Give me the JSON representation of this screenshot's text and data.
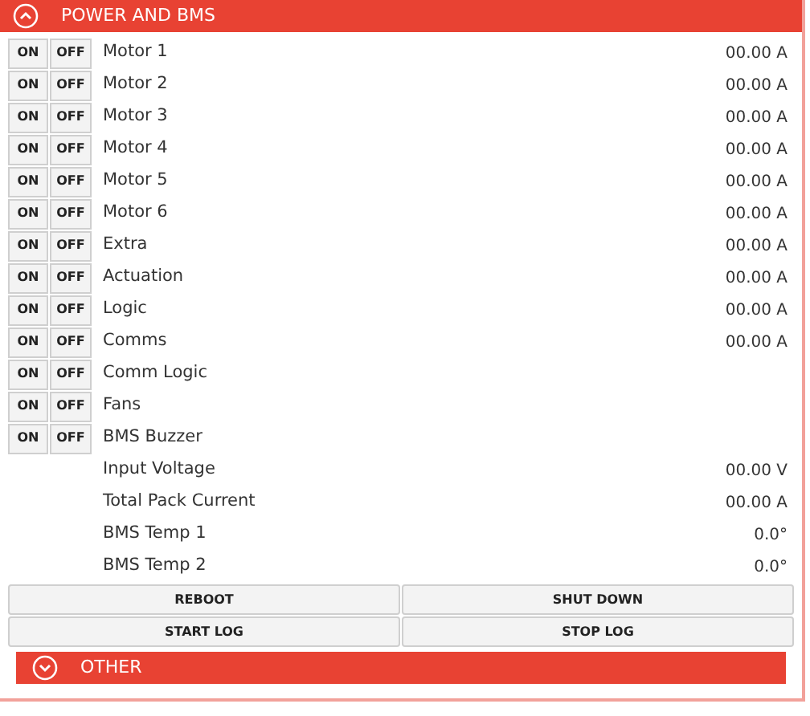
{
  "sections": [
    {
      "title": "POWER AND BMS",
      "expanded": true,
      "rows": [
        {
          "kind": "switch",
          "on_label": "ON",
          "off_label": "OFF",
          "label": "Motor 1",
          "reading": "00.00 A"
        },
        {
          "kind": "switch",
          "on_label": "ON",
          "off_label": "OFF",
          "label": "Motor 2",
          "reading": "00.00 A"
        },
        {
          "kind": "switch",
          "on_label": "ON",
          "off_label": "OFF",
          "label": "Motor 3",
          "reading": "00.00 A"
        },
        {
          "kind": "switch",
          "on_label": "ON",
          "off_label": "OFF",
          "label": "Motor 4",
          "reading": "00.00 A"
        },
        {
          "kind": "switch",
          "on_label": "ON",
          "off_label": "OFF",
          "label": "Motor 5",
          "reading": "00.00 A"
        },
        {
          "kind": "switch",
          "on_label": "ON",
          "off_label": "OFF",
          "label": "Motor 6",
          "reading": "00.00 A"
        },
        {
          "kind": "switch",
          "on_label": "ON",
          "off_label": "OFF",
          "label": "Extra",
          "reading": "00.00 A"
        },
        {
          "kind": "switch",
          "on_label": "ON",
          "off_label": "OFF",
          "label": "Actuation",
          "reading": "00.00 A"
        },
        {
          "kind": "switch",
          "on_label": "ON",
          "off_label": "OFF",
          "label": "Logic",
          "reading": "00.00 A"
        },
        {
          "kind": "switch",
          "on_label": "ON",
          "off_label": "OFF",
          "label": "Comms",
          "reading": "00.00 A"
        },
        {
          "kind": "switch",
          "on_label": "ON",
          "off_label": "OFF",
          "label": "Comm Logic"
        },
        {
          "kind": "switch",
          "on_label": "ON",
          "off_label": "OFF",
          "label": "Fans"
        },
        {
          "kind": "switch",
          "on_label": "ON",
          "off_label": "OFF",
          "label": "BMS Buzzer"
        },
        {
          "kind": "reading",
          "label": "Input Voltage",
          "reading": "00.00 V"
        },
        {
          "kind": "reading",
          "label": "Total Pack Current",
          "reading": "00.00 A"
        },
        {
          "kind": "reading",
          "label": "BMS Temp 1",
          "reading": "0.0°"
        },
        {
          "kind": "reading",
          "label": "BMS Temp 2",
          "reading": "0.0°"
        }
      ],
      "buttons": [
        "REBOOT",
        "SHUT DOWN",
        "START LOG",
        "STOP LOG"
      ]
    },
    {
      "title": "OTHER",
      "expanded": false
    }
  ]
}
